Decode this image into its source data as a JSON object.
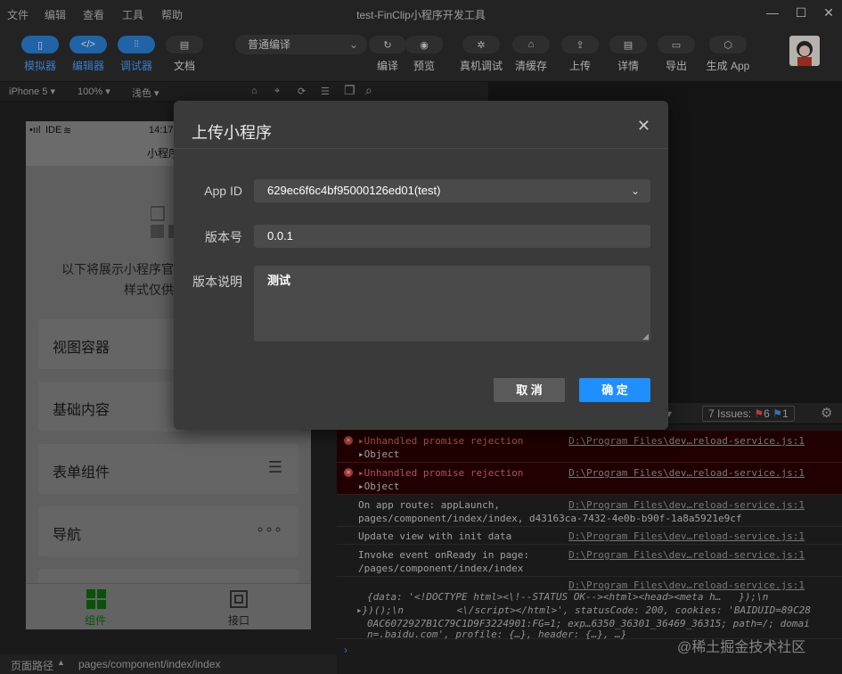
{
  "menubar": {
    "items": [
      "文件",
      "编辑",
      "查看",
      "工具",
      "帮助"
    ],
    "title": "test-FinClip小程序开发工具",
    "window_controls": [
      "—",
      "☐",
      "✕"
    ]
  },
  "toolbar": {
    "simulator": "模拟器",
    "editor": "编辑器",
    "debugger": "调试器",
    "docs": "文档",
    "compile_mode": "普通编译",
    "compile": "编译",
    "preview": "预览",
    "real_debug": "真机调试",
    "clear_cache": "清缓存",
    "upload": "上传",
    "details": "详情",
    "export": "导出",
    "gen_app": "生成 App"
  },
  "subbar": {
    "device": "iPhone 5",
    "zoom": "100%",
    "theme": "浅色"
  },
  "phone": {
    "carrier": "IDE",
    "time": "14:17",
    "nav_title": "小程序组",
    "intro_line1": "以下将展示小程序官",
    "intro_line2": "样式仅供",
    "cards": [
      "视图容器",
      "基础内容",
      "表单组件",
      "导航"
    ],
    "tab_component": "组件",
    "tab_api": "接口"
  },
  "bottom_status": {
    "label": "页面路径",
    "path": "pages/component/index/index"
  },
  "console": {
    "level": "ls ▾",
    "issues": "7 Issues:",
    "err_count": "6",
    "info_count": "1",
    "logs": [
      {
        "msg": "Unhandled promise rejection",
        "sub": "Object",
        "src": "D:\\Program Files\\dev…reload-service.js:1",
        "err": true
      },
      {
        "msg": "Unhandled promise rejection",
        "sub": "Object",
        "src": "D:\\Program Files\\dev…reload-service.js:1",
        "err": true
      },
      {
        "msg": "On app route: appLaunch,",
        "sub": "pages/component/index/index, d43163ca-7432-4e0b-b90f-1a8a5921e9cf",
        "src": "D:\\Program Files\\dev…reload-service.js:1",
        "err": false
      },
      {
        "msg": "Update view with init data",
        "sub": "",
        "src": "D:\\Program Files\\dev…reload-service.js:1",
        "err": false
      },
      {
        "msg": "Invoke event onReady in page:",
        "sub": "/pages/component/index/index",
        "src": "D:\\Program Files\\dev…reload-service.js:1",
        "err": false
      }
    ],
    "obj_src": "D:\\Program Files\\dev…reload-service.js:1",
    "obj_line1": "{data: '<!DOCTYPE html><\\!--STATUS OK--><html><head><meta h…   });\\n",
    "obj_line2": "})();\\n         <\\/script></html>', statusCode: 200, cookies: 'BAIDUID=89C28",
    "obj_line3": "0AC6072927B1C79C1D9F3224901:FG=1; exp…6350_36301_36469_36315; path=/; domai",
    "obj_line4": "n=.baidu.com', profile: {…}, header: {…}, …}"
  },
  "watermark": "@稀土掘金技术社区",
  "modal": {
    "title": "上传小程序",
    "appid_label": "App ID",
    "appid_value": "629ec6f6c4bf95000126ed01(test)",
    "version_label": "版本号",
    "version_value": "0.0.1",
    "desc_label": "版本说明",
    "desc_value": "测试",
    "cancel": "取 消",
    "ok": "确 定"
  }
}
